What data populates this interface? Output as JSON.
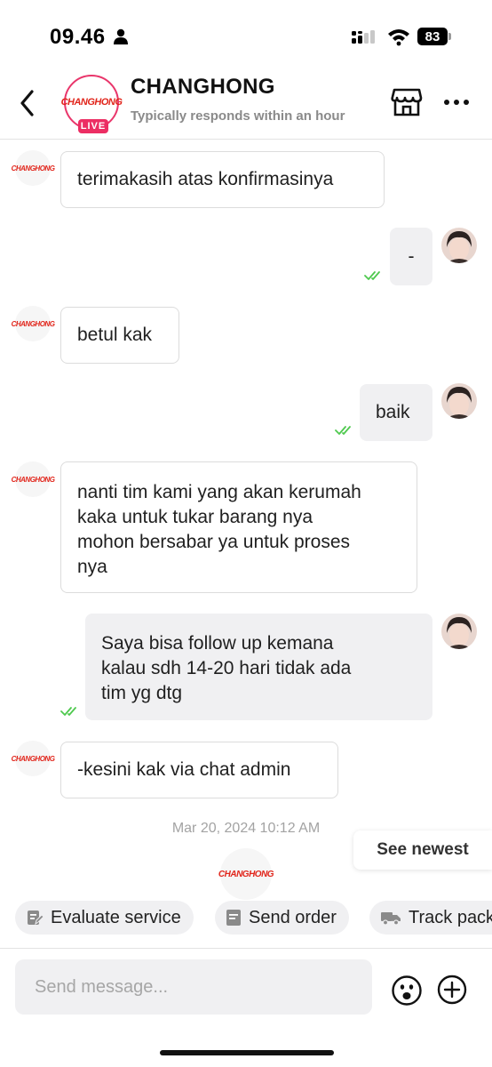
{
  "status_bar": {
    "time": "09.46",
    "battery": "83"
  },
  "header": {
    "shop_name": "CHANGHONG",
    "subtitle": "Typically responds within an hour",
    "logo_text": "CHANGHONG",
    "live_badge": "LIVE"
  },
  "messages": [
    {
      "from": "shop",
      "text": "terimakasih atas konfirmasinya",
      "avatar_text": "CHANGHONG"
    },
    {
      "from": "user",
      "text": "-",
      "read": true
    },
    {
      "from": "shop",
      "text": "betul kak",
      "avatar_text": "CHANGHONG"
    },
    {
      "from": "user",
      "text": "baik",
      "read": true
    },
    {
      "from": "shop",
      "lines": [
        "nanti tim kami yang akan kerumah",
        "kaka untuk tukar barang nya",
        "mohon bersabar ya untuk proses",
        "nya"
      ],
      "avatar_text": "CHANGHONG"
    },
    {
      "from": "user",
      "lines": [
        "Saya bisa follow up kemana",
        "kalau sdh 14-20 hari tidak ada",
        "tim yg dtg"
      ],
      "read": true
    },
    {
      "from": "shop",
      "text": "-kesini kak via chat admin",
      "avatar_text": "CHANGHONG"
    }
  ],
  "timestamp": "Mar 20, 2024 10:12 AM",
  "see_newest": "See newest",
  "bottom_avatar_text": "CHANGHONG",
  "quick_actions": [
    "Evaluate service",
    "Send order",
    "Track pack"
  ],
  "composer": {
    "placeholder": "Send message..."
  },
  "colors": {
    "brand_red": "#e1251b",
    "live_pink": "#ec2e63",
    "read_check": "#4fc94f"
  }
}
